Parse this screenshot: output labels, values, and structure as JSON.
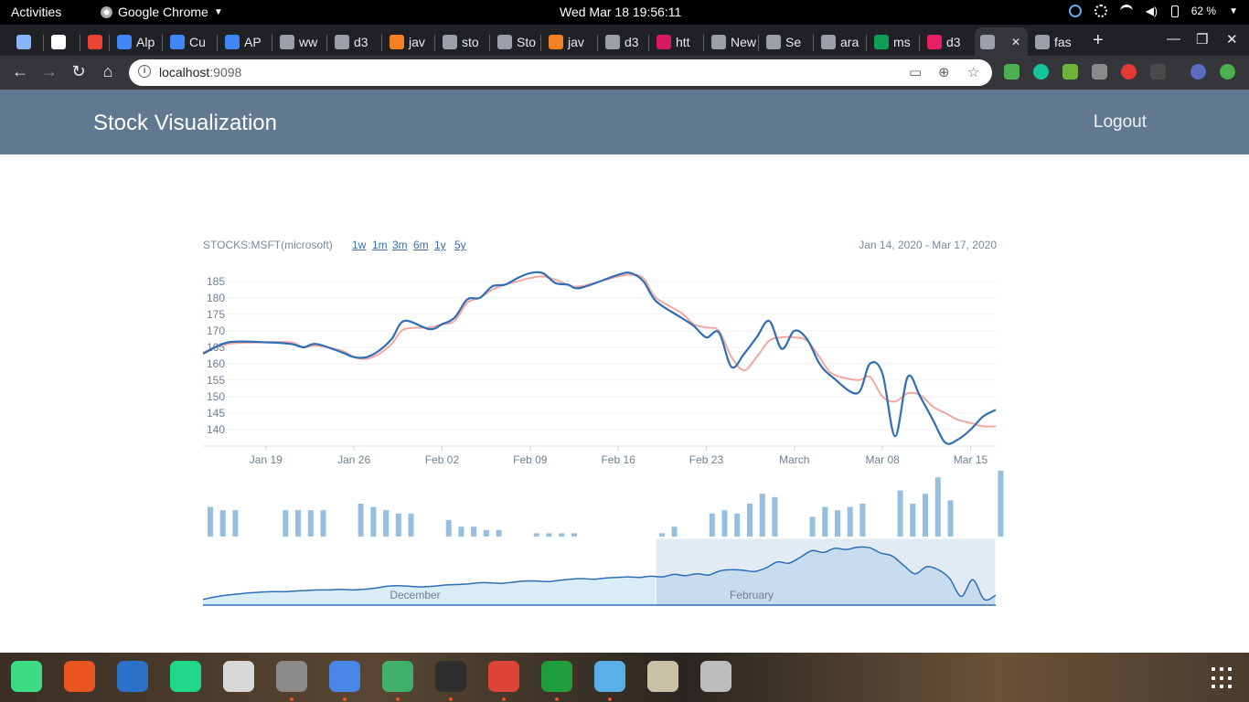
{
  "system": {
    "activities": "Activities",
    "app_name": "Google Chrome",
    "clock": "Wed Mar 18  19:56:11",
    "battery": "62 %"
  },
  "tabs": [
    {
      "label": "",
      "color": "#8ab4f8"
    },
    {
      "label": "",
      "color": "#ffffff"
    },
    {
      "label": "",
      "color": "#ea4335"
    },
    {
      "label": "Alp",
      "color": "#4285f4"
    },
    {
      "label": "Cu",
      "color": "#4285f4"
    },
    {
      "label": "AP",
      "color": "#4285f4"
    },
    {
      "label": "ww",
      "color": "#9aa0a6"
    },
    {
      "label": "d3",
      "color": "#9aa0a6"
    },
    {
      "label": "jav",
      "color": "#f48024"
    },
    {
      "label": "sto",
      "color": "#9aa0a6"
    },
    {
      "label": "Sto",
      "color": "#9aa0a6"
    },
    {
      "label": "jav",
      "color": "#f48024"
    },
    {
      "label": "d3",
      "color": "#9aa0a6"
    },
    {
      "label": "htt",
      "color": "#d81b60"
    },
    {
      "label": "New T",
      "color": "#9aa0a6"
    },
    {
      "label": "Se",
      "color": "#9aa0a6"
    },
    {
      "label": "ara",
      "color": "#9aa0a6"
    },
    {
      "label": "ms",
      "color": "#0f9d58"
    },
    {
      "label": "d3",
      "color": "#e91e63"
    },
    {
      "label": "",
      "color": "#9aa0a6"
    },
    {
      "label": "fas",
      "color": "#9aa0a6"
    }
  ],
  "browser": {
    "url_host": "localhost",
    "url_port": ":9098"
  },
  "app": {
    "title": "Stock Visualization",
    "logout": "Logout",
    "stock_label": "STOCKS:MSFT(microsoft)",
    "ranges": [
      "1w",
      "1m",
      "3m",
      "6m",
      "1y",
      "5y"
    ],
    "date_range": "Jan 14, 2020 - Mar 17, 2020"
  },
  "chart_data": [
    {
      "type": "line",
      "title": "",
      "y_ticks": [
        140,
        145,
        150,
        155,
        160,
        165,
        170,
        175,
        180,
        185
      ],
      "ylim": [
        135,
        188
      ],
      "x_ticks": [
        "Jan 19",
        "Jan 26",
        "Feb 02",
        "Feb 09",
        "Feb 16",
        "Feb 23",
        "March",
        "Mar 08",
        "Mar 15"
      ],
      "x_tick_days": [
        5,
        12,
        19,
        26,
        33,
        40,
        47,
        54,
        61
      ],
      "xlim_days": [
        0,
        63
      ],
      "grid": true,
      "series": [
        {
          "color": "#2f6eb5",
          "x_days": [
            0,
            2,
            5,
            7,
            8,
            9,
            11,
            12,
            13,
            14,
            15,
            16,
            18,
            19,
            20,
            21,
            22,
            23,
            24,
            25,
            26,
            27,
            28,
            29,
            30,
            33,
            34,
            35,
            36,
            38,
            39,
            40,
            41,
            42,
            43,
            44,
            45,
            46,
            47,
            48,
            49,
            50,
            52,
            53,
            54,
            55,
            56,
            57,
            58,
            59,
            60,
            61,
            62,
            63
          ],
          "values": [
            163,
            166.5,
            166.5,
            166,
            165,
            166,
            163.5,
            162,
            162,
            164,
            167.5,
            173,
            170.5,
            172,
            174,
            179.5,
            180,
            183.5,
            184,
            186,
            187.5,
            187.5,
            184.5,
            184,
            183,
            187,
            187.5,
            185,
            179,
            174,
            171.5,
            168,
            169.5,
            159,
            163,
            168,
            173,
            164.5,
            170,
            167.5,
            160,
            156,
            151,
            160,
            157,
            138,
            156,
            150,
            143,
            136,
            137,
            140,
            144,
            146
          ]
        },
        {
          "color": "#f4a6a0",
          "x_days": [
            0,
            2,
            5,
            7,
            8,
            9,
            11,
            12,
            13,
            14,
            15,
            16,
            18,
            19,
            20,
            21,
            22,
            23,
            24,
            25,
            26,
            27,
            28,
            29,
            30,
            33,
            34,
            35,
            36,
            38,
            39,
            40,
            41,
            42,
            43,
            44,
            45,
            46,
            47,
            48,
            49,
            50,
            52,
            53,
            54,
            55,
            56,
            57,
            58,
            59,
            60,
            61,
            62,
            63
          ],
          "values": [
            163.5,
            166,
            166.5,
            166.5,
            165,
            165.5,
            164,
            162,
            161.5,
            163,
            166,
            170.5,
            171,
            172,
            173,
            178.5,
            180,
            182.5,
            184,
            185,
            186,
            186.5,
            185.5,
            184,
            183.5,
            186.5,
            187,
            186,
            180,
            175.5,
            172,
            171,
            170,
            162,
            158,
            162,
            167,
            168,
            168,
            167,
            162,
            157,
            155,
            156,
            150,
            148.5,
            151,
            150.5,
            147,
            145,
            143,
            142,
            141,
            141
          ]
        }
      ]
    },
    {
      "type": "bar",
      "title": "",
      "values": [
        9,
        8,
        8,
        0,
        0,
        0,
        8,
        8,
        8,
        8,
        0,
        0,
        10,
        9,
        8,
        7,
        7,
        0,
        0,
        5,
        3,
        3,
        2,
        2,
        0,
        0,
        1,
        1,
        1,
        1,
        0,
        0,
        0,
        0,
        0,
        0,
        1,
        3,
        0,
        0,
        7,
        8,
        7,
        10,
        13,
        12,
        0,
        0,
        6,
        9,
        8,
        9,
        10,
        0,
        0,
        14,
        10,
        13,
        18,
        11,
        0,
        0,
        0,
        20
      ],
      "color": "#94bfe0"
    },
    {
      "type": "area",
      "title": "",
      "x_labels": [
        "December",
        "February"
      ],
      "color": "#2f6eb5",
      "fill": "#d8ecfa",
      "brush": {
        "from": 0.571,
        "to": 1.0
      },
      "values": [
        0.05,
        0.09,
        0.12,
        0.14,
        0.16,
        0.17,
        0.18,
        0.18,
        0.19,
        0.2,
        0.21,
        0.21,
        0.22,
        0.21,
        0.22,
        0.24,
        0.27,
        0.28,
        0.27,
        0.26,
        0.27,
        0.29,
        0.3,
        0.31,
        0.33,
        0.33,
        0.32,
        0.34,
        0.36,
        0.36,
        0.35,
        0.37,
        0.39,
        0.4,
        0.39,
        0.41,
        0.42,
        0.43,
        0.42,
        0.44,
        0.43,
        0.47,
        0.45,
        0.48,
        0.46,
        0.53,
        0.55,
        0.54,
        0.52,
        0.58,
        0.68,
        0.66,
        0.76,
        0.87,
        0.84,
        0.91,
        0.89,
        0.93,
        0.92,
        0.83,
        0.78,
        0.62,
        0.48,
        0.6,
        0.55,
        0.4,
        0.1,
        0.38,
        0.05,
        0.12
      ]
    }
  ],
  "dock": [
    {
      "name": "android-studio-icon",
      "color": "#3ddc84",
      "running": false
    },
    {
      "name": "software-center-icon",
      "color": "#e95420",
      "running": false
    },
    {
      "name": "libreoffice-writer-icon",
      "color": "#2a72c9",
      "running": false
    },
    {
      "name": "pycharm-icon",
      "color": "#21d789",
      "running": false
    },
    {
      "name": "magnifier-icon",
      "color": "#d8d8d8",
      "running": false
    },
    {
      "name": "settings-icon",
      "color": "#8a8a8a",
      "running": true
    },
    {
      "name": "archive-icon",
      "color": "#4a86e8",
      "running": true
    },
    {
      "name": "atom-icon",
      "color": "#40b06b",
      "running": true
    },
    {
      "name": "terminal-icon",
      "color": "#2e2e2e",
      "running": true
    },
    {
      "name": "chrome-icon",
      "color": "#db4437",
      "running": true
    },
    {
      "name": "libreoffice-calc-icon",
      "color": "#1e9e3a",
      "running": true
    },
    {
      "name": "pinwheel-icon",
      "color": "#5ab0e6",
      "running": true
    },
    {
      "name": "file-manager-icon",
      "color": "#c9c1a6",
      "running": false
    },
    {
      "name": "disk-icon",
      "color": "#bdbdbd",
      "running": false
    }
  ]
}
